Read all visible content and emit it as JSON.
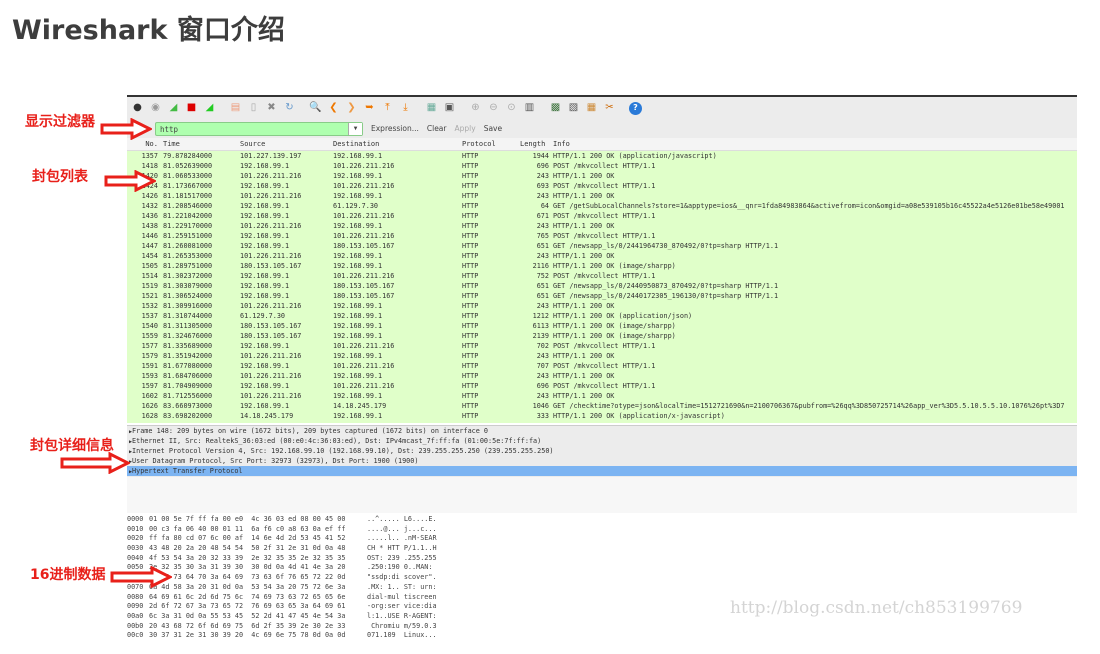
{
  "title": "Wireshark 窗口介绍",
  "labels": {
    "filter": "显示过滤器",
    "list": "封包列表",
    "details": "封包详细信息",
    "hex": "16进制数据"
  },
  "toolbar_icons": [
    "interface-list-icon",
    "capture-options-icon",
    "start-capture-icon",
    "stop-capture-icon",
    "restart-capture-icon",
    "open-file-icon",
    "save-file-icon",
    "close-file-icon",
    "reload-icon",
    "find-icon",
    "back-icon",
    "forward-icon",
    "goto-icon",
    "first-packet-icon",
    "last-packet-icon",
    "colorize-icon",
    "autoscroll-icon",
    "zoom-in-icon",
    "zoom-out-icon",
    "normal-size-icon",
    "resize-columns-icon",
    "capture-filters-icon",
    "display-filters-icon",
    "coloring-rules-icon",
    "preferences-icon",
    "help-icon"
  ],
  "filter": {
    "value": "http",
    "expression": "Expression...",
    "clear": "Clear",
    "apply": "Apply",
    "save": "Save"
  },
  "columns": [
    "No.",
    "Time",
    "Source",
    "Destination",
    "Protocol",
    "Length",
    "Info"
  ],
  "packets": [
    [
      "1357",
      "79.878284000",
      "101.227.139.197",
      "192.168.99.1",
      "HTTP",
      "1944",
      "HTTP/1.1 200 OK  (application/javascript)"
    ],
    [
      "1418",
      "81.052639000",
      "192.168.99.1",
      "101.226.211.216",
      "HTTP",
      "696",
      "POST /mkvcollect HTTP/1.1"
    ],
    [
      "1420",
      "81.060533000",
      "101.226.211.216",
      "192.168.99.1",
      "HTTP",
      "243",
      "HTTP/1.1 200 OK"
    ],
    [
      "1424",
      "81.173667000",
      "192.168.99.1",
      "101.226.211.216",
      "HTTP",
      "693",
      "POST /mkvcollect HTTP/1.1"
    ],
    [
      "1426",
      "81.181517000",
      "101.226.211.216",
      "192.168.99.1",
      "HTTP",
      "243",
      "HTTP/1.1 200 OK"
    ],
    [
      "1432",
      "81.208546000",
      "192.168.99.1",
      "61.129.7.30",
      "HTTP",
      "64",
      "GET /getSubLocalChannels?store=1&apptype=ios&__qnr=1fda84983864&activefrom=icon&omgid=a08e539105b16c45522a4e5126e01be58e49001"
    ],
    [
      "1436",
      "81.221042000",
      "192.168.99.1",
      "101.226.211.216",
      "HTTP",
      "671",
      "POST /mkvcollect HTTP/1.1"
    ],
    [
      "1438",
      "81.229170000",
      "101.226.211.216",
      "192.168.99.1",
      "HTTP",
      "243",
      "HTTP/1.1 200 OK"
    ],
    [
      "1446",
      "81.259151000",
      "192.168.99.1",
      "101.226.211.216",
      "HTTP",
      "765",
      "POST /mkvcollect HTTP/1.1"
    ],
    [
      "1447",
      "81.260081000",
      "192.168.99.1",
      "180.153.105.167",
      "HTTP",
      "651",
      "GET /newsapp_ls/0/2441964730_870492/0?tp=sharp HTTP/1.1"
    ],
    [
      "1454",
      "81.265353000",
      "101.226.211.216",
      "192.168.99.1",
      "HTTP",
      "243",
      "HTTP/1.1 200 OK"
    ],
    [
      "1505",
      "81.289751000",
      "180.153.105.167",
      "192.168.99.1",
      "HTTP",
      "2116",
      "HTTP/1.1 200 OK  (image/sharpp)"
    ],
    [
      "1514",
      "81.302372000",
      "192.168.99.1",
      "101.226.211.216",
      "HTTP",
      "752",
      "POST /mkvcollect HTTP/1.1"
    ],
    [
      "1519",
      "81.303079000",
      "192.168.99.1",
      "180.153.105.167",
      "HTTP",
      "651",
      "GET /newsapp_ls/0/2440950873_870492/0?tp=sharp HTTP/1.1"
    ],
    [
      "1521",
      "81.306524000",
      "192.168.99.1",
      "180.153.105.167",
      "HTTP",
      "651",
      "GET /newsapp_ls/0/2440172305_196130/0?tp=sharp HTTP/1.1"
    ],
    [
      "1532",
      "81.309916000",
      "101.226.211.216",
      "192.168.99.1",
      "HTTP",
      "243",
      "HTTP/1.1 200 OK"
    ],
    [
      "1537",
      "81.310744000",
      "61.129.7.30",
      "192.168.99.1",
      "HTTP",
      "1212",
      "HTTP/1.1 200 OK  (application/json)"
    ],
    [
      "1540",
      "81.311305000",
      "180.153.105.167",
      "192.168.99.1",
      "HTTP",
      "6113",
      "HTTP/1.1 200 OK  (image/sharpp)"
    ],
    [
      "1559",
      "81.324676000",
      "180.153.105.167",
      "192.168.99.1",
      "HTTP",
      "2139",
      "HTTP/1.1 200 OK  (image/sharpp)"
    ],
    [
      "1577",
      "81.335689000",
      "192.168.99.1",
      "101.226.211.216",
      "HTTP",
      "702",
      "POST /mkvcollect HTTP/1.1"
    ],
    [
      "1579",
      "81.351942000",
      "101.226.211.216",
      "192.168.99.1",
      "HTTP",
      "243",
      "HTTP/1.1 200 OK"
    ],
    [
      "1591",
      "81.677080000",
      "192.168.99.1",
      "101.226.211.216",
      "HTTP",
      "707",
      "POST /mkvcollect HTTP/1.1"
    ],
    [
      "1593",
      "81.684706000",
      "101.226.211.216",
      "192.168.99.1",
      "HTTP",
      "243",
      "HTTP/1.1 200 OK"
    ],
    [
      "1597",
      "81.704909000",
      "192.168.99.1",
      "101.226.211.216",
      "HTTP",
      "696",
      "POST /mkvcollect HTTP/1.1"
    ],
    [
      "1602",
      "81.712556000",
      "101.226.211.216",
      "192.168.99.1",
      "HTTP",
      "243",
      "HTTP/1.1 200 OK"
    ],
    [
      "1626",
      "83.660973000",
      "192.168.99.1",
      "14.18.245.179",
      "HTTP",
      "1046",
      "GET /checktime?otype=json&localTime=1512721690&n=2100706367&pubfrom=%26qq%3D850725714%26app_ver%3D5.5.10.5.5.10.1076%26pt%3D7"
    ],
    [
      "1628",
      "83.698202000",
      "14.18.245.179",
      "192.168.99.1",
      "HTTP",
      "333",
      "HTTP/1.1 200 OK  (application/x-javascript)"
    ]
  ],
  "details": [
    "Frame 148: 209 bytes on wire (1672 bits), 209 bytes captured (1672 bits) on interface 0",
    "Ethernet II, Src: RealtekS_36:03:ed (00:e0:4c:36:03:ed), Dst: IPv4mcast_7f:ff:fa (01:00:5e:7f:ff:fa)",
    "Internet Protocol Version 4, Src: 192.168.99.10 (192.168.99.10), Dst: 239.255.255.250 (239.255.255.250)",
    "User Datagram Protocol, Src Port: 32973 (32973), Dst Port: 1900 (1900)",
    "Hypertext Transfer Protocol"
  ],
  "hex": [
    [
      "0000",
      "01 00 5e 7f ff fa 00 e0  4c 36 03 ed 08 00 45 00",
      "..^..... L6....E."
    ],
    [
      "0010",
      "00 c3 fa 06 40 00 01 11  6a f6 c0 a8 63 0a ef ff",
      "....@... j...c..."
    ],
    [
      "0020",
      "ff fa 80 cd 07 6c 00 af  14 6e 4d 2d 53 45 41 52",
      ".....l.. .nM-SEAR"
    ],
    [
      "0030",
      "43 48 20 2a 20 48 54 54  50 2f 31 2e 31 0d 0a 48",
      "CH * HTT P/1.1..H"
    ],
    [
      "0040",
      "4f 53 54 3a 20 32 33 39  2e 32 35 35 2e 32 35 35",
      "OST: 239 .255.255"
    ],
    [
      "0050",
      "2e 32 35 30 3a 31 39 30  30 0d 0a 4d 41 4e 3a 20",
      ".250:190 0..MAN: "
    ],
    [
      "0060",
      "22 73 73 64 70 3a 64 69  73 63 6f 76 65 72 22 0d",
      "\"ssdp:di scover\"."
    ],
    [
      "0070",
      "0a 4d 58 3a 20 31 0d 0a  53 54 3a 20 75 72 6e 3a",
      ".MX: 1.. ST: urn:"
    ],
    [
      "0080",
      "64 69 61 6c 2d 6d 75 6c  74 69 73 63 72 65 65 6e",
      "dial-mul tiscreen"
    ],
    [
      "0090",
      "2d 6f 72 67 3a 73 65 72  76 69 63 65 3a 64 69 61",
      "-org:ser vice:dia"
    ],
    [
      "00a0",
      "6c 3a 31 0d 0a 55 53 45  52 2d 41 47 45 4e 54 3a",
      "l:1..USE R-AGENT:"
    ],
    [
      "00b0",
      "20 43 68 72 6f 6d 69 75  6d 2f 35 39 2e 30 2e 33",
      " Chromiu m/59.0.3"
    ],
    [
      "00c0",
      "30 37 31 2e 31 30 39 20  4c 69 6e 75 78 0d 0a 0d",
      "071.109  Linux..."
    ]
  ],
  "watermark": "http://blog.csdn.net/ch853199769"
}
